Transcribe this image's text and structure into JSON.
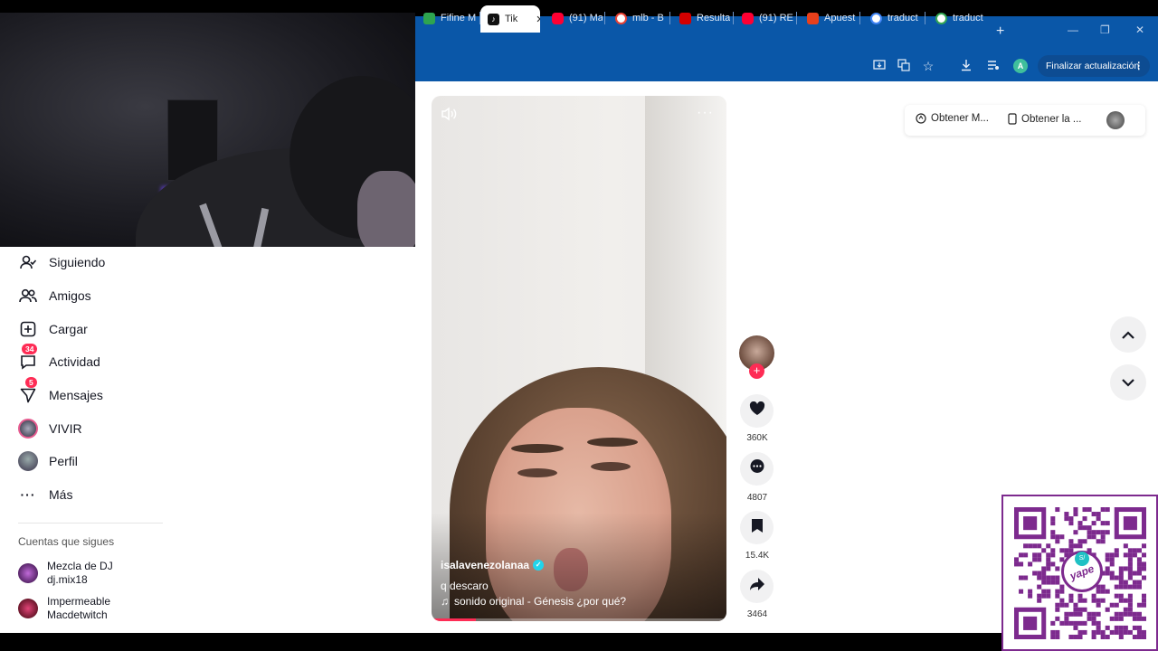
{
  "browser": {
    "tabs": [
      {
        "label": "Fifine M",
        "icon": "fifine-icon",
        "color": "#2ea44f"
      },
      {
        "label": "Tik",
        "icon": "tiktok-icon",
        "color": "#111111",
        "active": true
      },
      {
        "label": "(91) Ma",
        "icon": "youtube-icon",
        "color": "#ff0033"
      },
      {
        "label": "mlb - B",
        "icon": "google-icon",
        "color": "#ffffff"
      },
      {
        "label": "Resulta",
        "icon": "stats-icon",
        "color": "#d40000"
      },
      {
        "label": "(91) RE",
        "icon": "youtube-icon",
        "color": "#ff0033"
      },
      {
        "label": "Apuest",
        "icon": "bet-icon",
        "color": "#e8401c"
      },
      {
        "label": "traduct",
        "icon": "google-icon",
        "color": "#ffffff"
      },
      {
        "label": "traduct",
        "icon": "google-icon",
        "color": "#ffffff"
      }
    ],
    "close_glyph": "✕",
    "new_tab_glyph": "+",
    "profile_initial": "A",
    "update_label": "Finalizar actualización"
  },
  "sidebar": {
    "items": [
      {
        "label": "Siguiendo",
        "icon": "following-icon"
      },
      {
        "label": "Amigos",
        "icon": "friends-icon"
      },
      {
        "label": "Cargar",
        "icon": "upload-icon"
      },
      {
        "label": "Actividad",
        "icon": "activity-icon",
        "badge": "34"
      },
      {
        "label": "Mensajes",
        "icon": "messages-icon",
        "badge": "5"
      },
      {
        "label": "VIVIR",
        "icon": "live-icon"
      },
      {
        "label": "Perfil",
        "icon": "profile-icon"
      },
      {
        "label": "Más",
        "icon": "more-icon"
      }
    ],
    "following_title": "Cuentas que sigues",
    "following": [
      {
        "name": "Mezcla de DJ",
        "handle": "dj.mix18"
      },
      {
        "name": "Impermeable",
        "handle": "Macdetwitch"
      }
    ]
  },
  "video": {
    "username": "isalavenezolanaa",
    "caption": "q descaro",
    "music": "sonido original - Génesis ¿por qué?",
    "progress": 0.15
  },
  "actions": {
    "likes": "360K",
    "comments": "4807",
    "saves": "15.4K",
    "shares": "3464"
  },
  "topbar": {
    "pill1": "Obtener M...",
    "pill2": "Obtener la ..."
  },
  "overlay": {
    "qr_brand": "yape",
    "qr_coin": "S/"
  },
  "colors": {
    "browser_chrome": "#0a57a8",
    "tiktok_red": "#fe2c55",
    "yape_purple": "#7d2a8e"
  }
}
